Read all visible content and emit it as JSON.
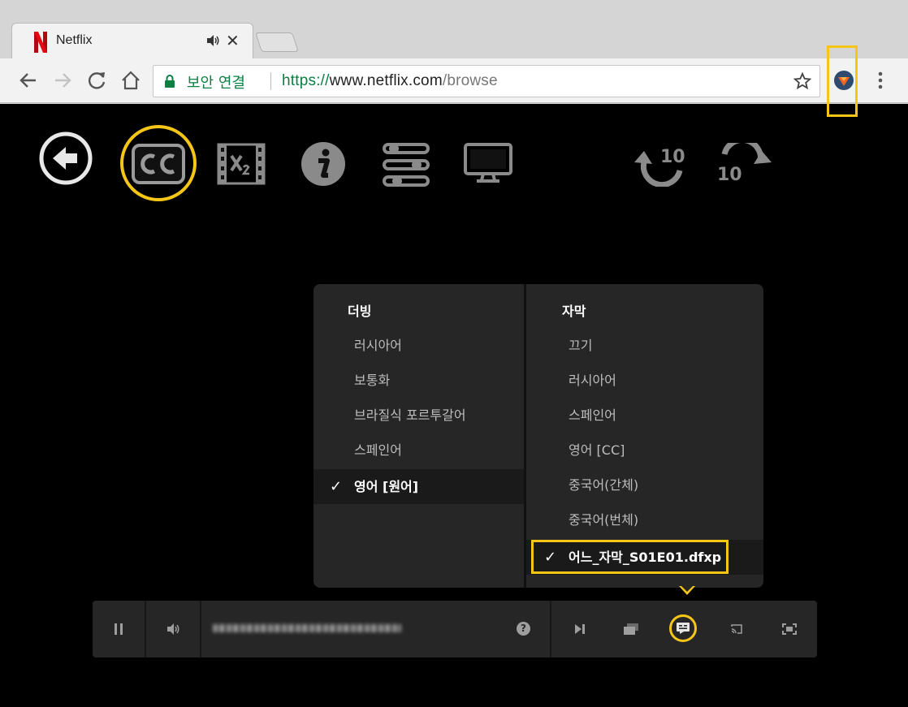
{
  "browser": {
    "tab_title": "Netflix",
    "tab_close": "✕",
    "security_label": "보안 연결",
    "url_scheme": "https://",
    "url_host": "www.netflix.com",
    "url_path": "/browse"
  },
  "audio_menu": {
    "header": "더빙",
    "options": [
      "러시아어",
      "보통화",
      "브라질식 포르투갈어",
      "스페인어",
      "영어 [원어]"
    ],
    "selected_index": 4
  },
  "subtitle_menu": {
    "header": "자막",
    "options": [
      "끄기",
      "러시아어",
      "스페인어",
      "영어 [CC]",
      "중국어(간체)",
      "중국어(번체)",
      "어느_자막_S01E01.dfxp"
    ],
    "selected_index": 6
  },
  "check_mark": "✓",
  "controls": {
    "help_label": "?"
  },
  "colors": {
    "highlight": "#f5c518",
    "netflix_red": "#e50914",
    "secure_green": "#0b8043",
    "panel_bg": "#262626"
  },
  "icons": [
    "back-icon",
    "forward-icon",
    "reload-icon",
    "home-icon",
    "lock-icon",
    "star-icon",
    "extension-icon",
    "menu-icon",
    "player-back-icon",
    "cc-icon",
    "speed-icon",
    "info-icon",
    "settings-icon",
    "display-icon",
    "rewind-10-icon",
    "forward-10-icon",
    "pause-icon",
    "volume-icon",
    "next-episode-icon",
    "episodes-icon",
    "subtitles-icon",
    "cast-icon",
    "fullscreen-icon"
  ]
}
